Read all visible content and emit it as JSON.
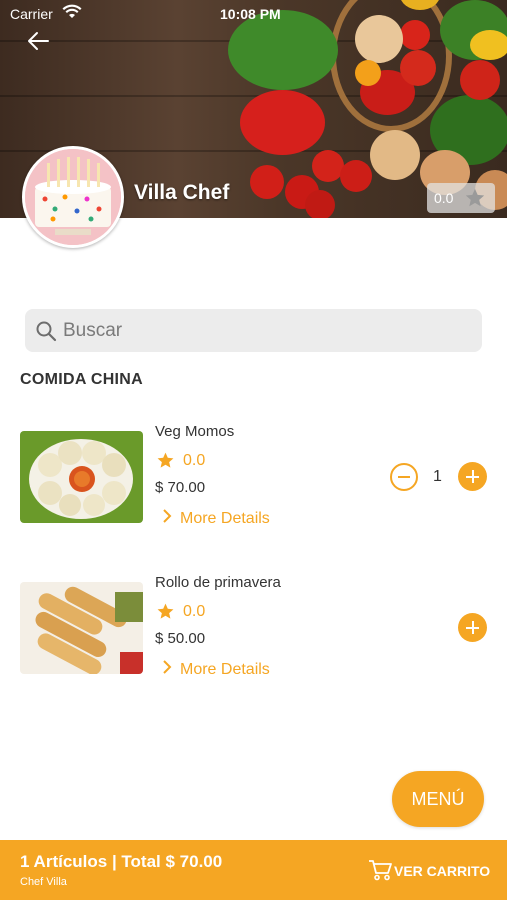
{
  "status_bar": {
    "carrier": "Carrier",
    "time": "10:08 PM"
  },
  "restaurant": {
    "name": "Villa Chef",
    "rating": "0.0"
  },
  "search": {
    "placeholder": "Buscar"
  },
  "section": {
    "title": "COMIDA CHINA"
  },
  "items": [
    {
      "name": "Veg Momos",
      "rating": "0.0",
      "price": "$ 70.00",
      "more": "More Details",
      "quantity": "1"
    },
    {
      "name": "Rollo de primavera",
      "rating": "0.0",
      "price": "$ 50.00",
      "more": "More Details"
    }
  ],
  "menu_button": {
    "label": "MENÚ"
  },
  "cart": {
    "summary": "1 Artículos | Total $ 70.00",
    "restaurant": "Chef Villa",
    "view_label": "VER CARRITO"
  },
  "colors": {
    "accent": "#f5a623",
    "search_bg": "#ececec",
    "text": "#333333"
  },
  "icons": [
    "wifi-icon",
    "back-arrow-icon",
    "star-icon",
    "search-icon",
    "chevron-right-icon",
    "minus-icon",
    "plus-icon",
    "cart-icon"
  ]
}
